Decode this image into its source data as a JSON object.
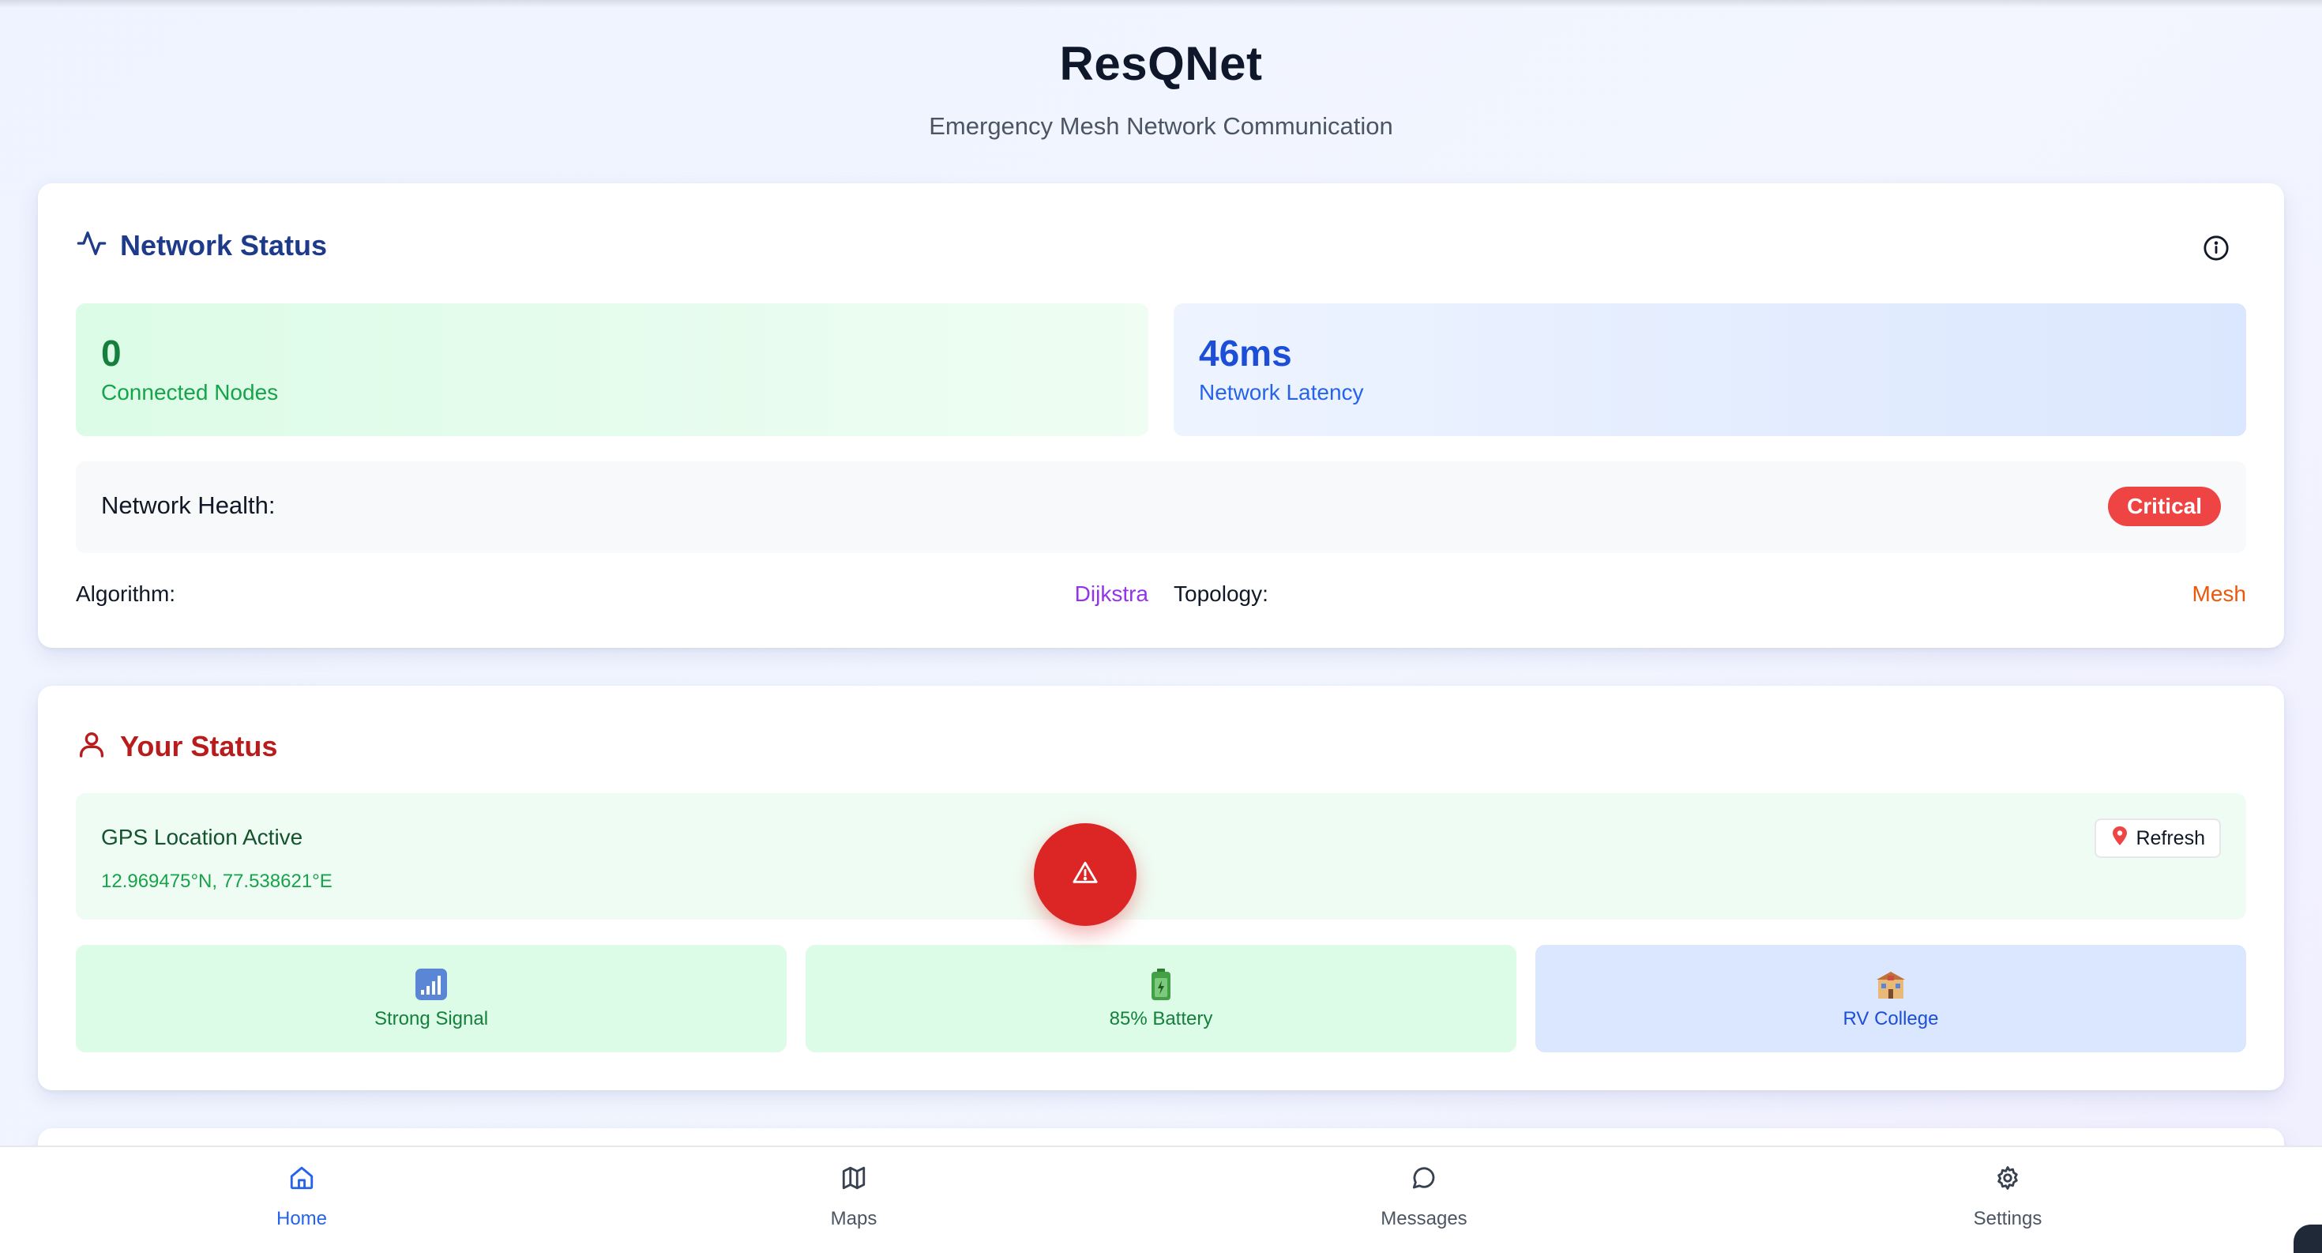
{
  "header": {
    "title": "ResQNet",
    "subtitle": "Emergency Mesh Network Communication"
  },
  "network_status": {
    "title": "Network Status",
    "title_icon": "activity-icon",
    "info_icon": "info-icon",
    "connected_nodes": {
      "value": "0",
      "label": "Connected Nodes"
    },
    "latency": {
      "value": "46ms",
      "label": "Network Latency"
    },
    "health": {
      "label": "Network Health:",
      "badge": "Critical"
    },
    "algorithm": {
      "label": "Algorithm:",
      "value": "Dijkstra"
    },
    "topology": {
      "label": "Topology:",
      "value": "Mesh"
    }
  },
  "your_status": {
    "title": "Your Status",
    "title_icon": "user-icon",
    "gps": {
      "title": "GPS Location Active",
      "coords": "12.969475°N, 77.538621°E",
      "refresh_label": "Refresh",
      "refresh_icon": "pin-icon"
    },
    "tiles": [
      {
        "icon": "signal-icon",
        "label": "Strong Signal"
      },
      {
        "icon": "battery-icon",
        "label": "85% Battery"
      },
      {
        "icon": "school-icon",
        "label": "RV College"
      }
    ]
  },
  "sos": {
    "icon": "warning-icon"
  },
  "nav": [
    {
      "label": "Home",
      "icon": "home-icon",
      "active": true
    },
    {
      "label": "Maps",
      "icon": "map-icon",
      "active": false
    },
    {
      "label": "Messages",
      "icon": "message-icon",
      "active": false
    },
    {
      "label": "Settings",
      "icon": "gear-icon",
      "active": false
    }
  ],
  "colors": {
    "critical": "#ef4444",
    "algorithm": "#9333ea",
    "topology": "#ea580c",
    "nav_active": "#2563eb",
    "sos": "#dc2626"
  }
}
